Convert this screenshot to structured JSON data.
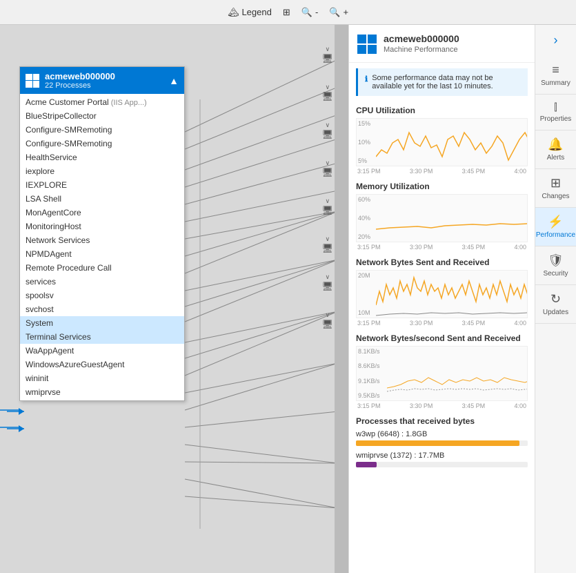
{
  "toolbar": {
    "legend_label": "Legend",
    "icons": [
      "⊞",
      "🔍-",
      "🔍+"
    ]
  },
  "process_box": {
    "title": "acmeweb000000",
    "subtitle": "22 Processes",
    "collapse_icon": "▲",
    "processes": [
      {
        "name": "Acme Customer Portal",
        "tag": " (IIS App...)",
        "selected": false
      },
      {
        "name": "BlueStripeCollector",
        "tag": "",
        "selected": false
      },
      {
        "name": "Configure-SMRemoting",
        "tag": "",
        "selected": false
      },
      {
        "name": "Configure-SMRemoting",
        "tag": "",
        "selected": false
      },
      {
        "name": "HealthService",
        "tag": "",
        "selected": false
      },
      {
        "name": "iexplore",
        "tag": "",
        "selected": false
      },
      {
        "name": "IEXPLORE",
        "tag": "",
        "selected": false
      },
      {
        "name": "LSA Shell",
        "tag": "",
        "selected": false
      },
      {
        "name": "MonAgentCore",
        "tag": "",
        "selected": false
      },
      {
        "name": "MonitoringHost",
        "tag": "",
        "selected": false
      },
      {
        "name": "Network Services",
        "tag": "",
        "selected": false
      },
      {
        "name": "NPMDAgent",
        "tag": "",
        "selected": false
      },
      {
        "name": "Remote Procedure Call",
        "tag": "",
        "selected": false
      },
      {
        "name": "services",
        "tag": "",
        "selected": false
      },
      {
        "name": "spoolsv",
        "tag": "",
        "selected": false
      },
      {
        "name": "svchost",
        "tag": "",
        "selected": false
      },
      {
        "name": "System",
        "tag": "",
        "selected": true
      },
      {
        "name": "Terminal Services",
        "tag": "",
        "selected": true
      },
      {
        "name": "WaAppAgent",
        "tag": "",
        "selected": false
      },
      {
        "name": "WindowsAzureGuestAgent",
        "tag": "",
        "selected": false
      },
      {
        "name": "wininit",
        "tag": "",
        "selected": false
      },
      {
        "name": "wmiprvse",
        "tag": "",
        "selected": false
      }
    ]
  },
  "detail_panel": {
    "machine_name": "acmeweb000000",
    "machine_subtitle": "Machine Performance",
    "info_message": "Some performance data may not be available yet for the last 10 minutes.",
    "charts": [
      {
        "title": "CPU Utilization",
        "y_labels": [
          "15%",
          "10%",
          "5%"
        ],
        "time_labels": [
          "3:15 PM",
          "3:30 PM",
          "3:45 PM",
          "4:00"
        ],
        "color": "#f5a623"
      },
      {
        "title": "Memory Utilization",
        "y_labels": [
          "60%",
          "40%",
          "20%"
        ],
        "time_labels": [
          "3:15 PM",
          "3:30 PM",
          "3:45 PM",
          "4:00"
        ],
        "color": "#f5a623"
      },
      {
        "title": "Network Bytes Sent and Received",
        "y_labels": [
          "20M",
          "10M"
        ],
        "time_labels": [
          "3:15 PM",
          "3:30 PM",
          "3:45 PM",
          "4:00"
        ],
        "color": "#f5a623"
      },
      {
        "title": "Network Bytes/second Sent and Received",
        "y_labels": [
          "8.1KB/s",
          "8.6KB/s",
          "9.1KB/s",
          "9.5KB/s"
        ],
        "time_labels": [
          "3:15 PM",
          "3:30 PM",
          "3:45 PM",
          "4:00"
        ],
        "color": "#f5a623"
      }
    ],
    "bytes_section": {
      "title": "Processes that received bytes",
      "items": [
        {
          "label": "w3wp (6648) : 1.8GB",
          "bar_width": "95%",
          "color": "#f5a623"
        },
        {
          "label": "wmiprvse (1372) : 17.7MB",
          "bar_width": "15%",
          "color": "#7b2d8b"
        }
      ]
    }
  },
  "nav_panel": {
    "items": [
      {
        "label": "Summary",
        "icon": "≡",
        "active": false
      },
      {
        "label": "Properties",
        "icon": "|||",
        "active": false
      },
      {
        "label": "Alerts",
        "icon": "🔔",
        "active": false
      },
      {
        "label": "Changes",
        "icon": "⊞",
        "active": false
      },
      {
        "label": "Performance",
        "icon": "⚡",
        "active": true
      },
      {
        "label": "Security",
        "icon": "🛡",
        "active": false
      },
      {
        "label": "Updates",
        "icon": "↻",
        "active": false
      }
    ]
  },
  "map": {
    "scroll_chevrons_top": [
      "∨",
      "∨",
      "∨",
      "∨",
      "∨",
      "∨",
      "∨"
    ],
    "monitor_icons": [
      "▭",
      "▭",
      "▭",
      "▭",
      "▭",
      "▭",
      "▭",
      "▭"
    ]
  }
}
